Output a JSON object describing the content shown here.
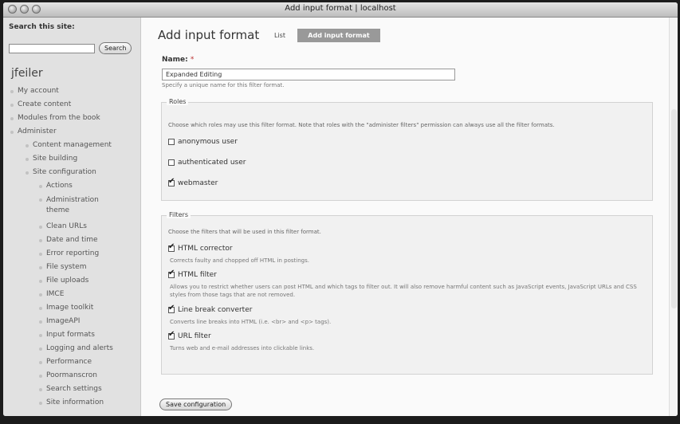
{
  "window": {
    "title": "Add input format | localhost"
  },
  "sidebar": {
    "search_label": "Search this site:",
    "search_value": "",
    "search_button": "Search",
    "username": "jfeiler",
    "nav": [
      {
        "label": "My account"
      },
      {
        "label": "Create content"
      },
      {
        "label": "Modules from the book"
      },
      {
        "label": "Administer"
      },
      {
        "label": "Content management"
      },
      {
        "label": "Site building"
      },
      {
        "label": "Site configuration"
      },
      {
        "label": "Actions"
      },
      {
        "label": "Administration theme"
      },
      {
        "label": "Clean URLs"
      },
      {
        "label": "Date and time"
      },
      {
        "label": "Error reporting"
      },
      {
        "label": "File system"
      },
      {
        "label": "File uploads"
      },
      {
        "label": "IMCE"
      },
      {
        "label": "Image toolkit"
      },
      {
        "label": "ImageAPI"
      },
      {
        "label": "Input formats"
      },
      {
        "label": "Logging and alerts"
      },
      {
        "label": "Performance"
      },
      {
        "label": "Poormanscron"
      },
      {
        "label": "Search settings"
      },
      {
        "label": "Site information"
      }
    ]
  },
  "main": {
    "title": "Add input format",
    "tabs": [
      {
        "label": "List"
      },
      {
        "label": "Add input format"
      }
    ],
    "name_label": "Name:",
    "name_required": "*",
    "name_value": "Expanded Editing",
    "name_description": "Specify a unique name for this filter format.",
    "roles": {
      "legend": "Roles",
      "description": "Choose which roles may use this filter format. Note that roles with the \"administer filters\" permission can always use all the filter formats.",
      "options": [
        {
          "label": "anonymous user",
          "checked": false
        },
        {
          "label": "authenticated user",
          "checked": false
        },
        {
          "label": "webmaster",
          "checked": true
        }
      ]
    },
    "filters": {
      "legend": "Filters",
      "description": "Choose the filters that will be used in this filter format.",
      "items": [
        {
          "label": "HTML corrector",
          "checked": true,
          "description": "Corrects faulty and chopped off HTML in postings."
        },
        {
          "label": "HTML filter",
          "checked": true,
          "description": "Allows you to restrict whether users can post HTML and which tags to filter out. It will also remove harmful content such as JavaScript events, JavaScript URLs and CSS styles from those tags that are not removed."
        },
        {
          "label": "Line break converter",
          "checked": true,
          "description": "Converts line breaks into HTML (i.e. <br> and <p> tags)."
        },
        {
          "label": "URL filter",
          "checked": true,
          "description": "Turns web and e-mail addresses into clickable links."
        }
      ]
    },
    "save_button": "Save configuration"
  }
}
